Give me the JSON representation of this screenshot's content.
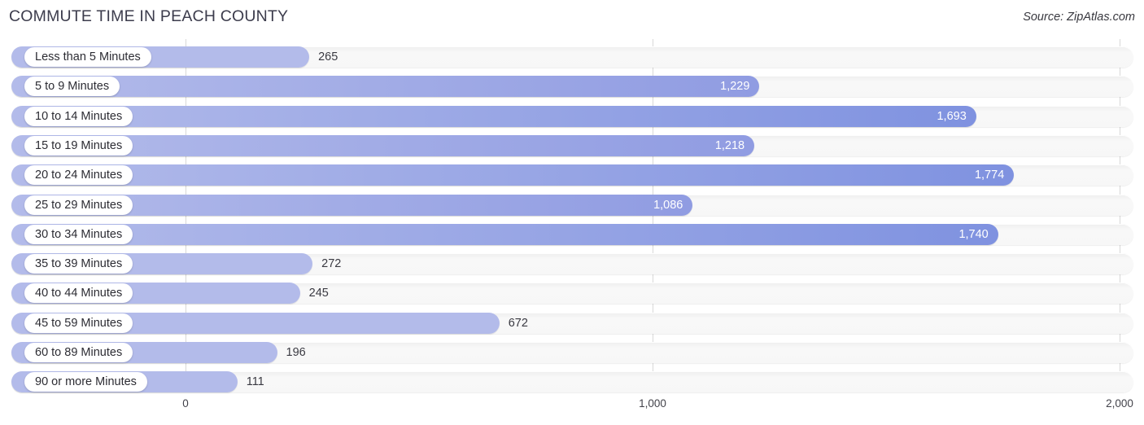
{
  "header": {
    "title": "COMMUTE TIME IN PEACH COUNTY",
    "source": "Source: ZipAtlas.com"
  },
  "chart_data": {
    "type": "bar",
    "orientation": "horizontal",
    "title": "COMMUTE TIME IN PEACH COUNTY",
    "xlabel": "",
    "ylabel": "",
    "xlim": [
      0,
      2000
    ],
    "grid": true,
    "legend": "none",
    "xticks": [
      "0",
      "1,000",
      "2,000"
    ],
    "xtick_values": [
      0,
      1000,
      2000
    ],
    "categories": [
      "Less than 5 Minutes",
      "5 to 9 Minutes",
      "10 to 14 Minutes",
      "15 to 19 Minutes",
      "20 to 24 Minutes",
      "25 to 29 Minutes",
      "30 to 34 Minutes",
      "35 to 39 Minutes",
      "40 to 44 Minutes",
      "45 to 59 Minutes",
      "60 to 89 Minutes",
      "90 or more Minutes"
    ],
    "values": [
      265,
      1229,
      1693,
      1218,
      1774,
      1086,
      1740,
      272,
      245,
      672,
      196,
      111
    ],
    "value_labels": [
      "265",
      "1,229",
      "1,693",
      "1,218",
      "1,774",
      "1,086",
      "1,740",
      "272",
      "245",
      "672",
      "196",
      "111"
    ]
  },
  "colors": {
    "bar_light": "#b3bbea",
    "bar_mid": "#909ce2",
    "bar_dark": "#7f92e0",
    "track": "#f7f7f7",
    "gridline": "#d8d8d8",
    "title_text": "#3c3c4c",
    "value_text_inside": "#ffffff",
    "value_text_outside": "#3a3a42"
  }
}
